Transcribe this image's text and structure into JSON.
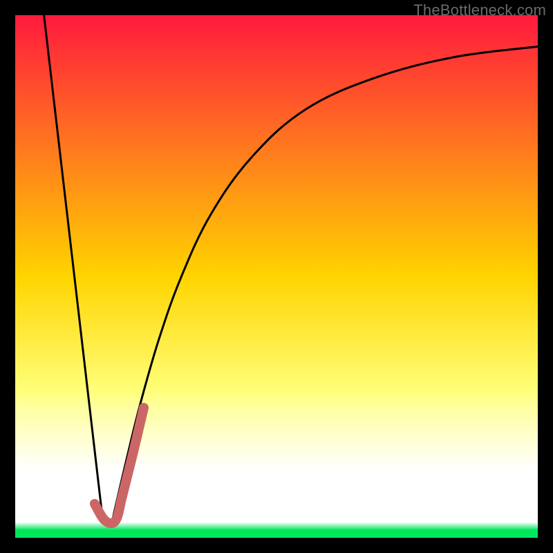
{
  "watermark": "TheBottleneck.com",
  "chart_data": {
    "type": "line",
    "title": "",
    "xlabel": "",
    "ylabel": "",
    "xlim": [
      0,
      100
    ],
    "ylim": [
      0,
      100
    ],
    "gradient_bands": [
      {
        "t": 0.0,
        "color": "#ff1a3d"
      },
      {
        "t": 0.5,
        "color": "#ffd400"
      },
      {
        "t": 0.72,
        "color": "#ffff7a"
      },
      {
        "t": 0.75,
        "color": "#ffffa0"
      },
      {
        "t": 0.8,
        "color": "#ffffc8"
      },
      {
        "t": 0.87,
        "color": "#ffffff"
      },
      {
        "t": 0.97,
        "color": "#ffffff"
      },
      {
        "t": 0.985,
        "color": "#00e75c"
      },
      {
        "t": 1.0,
        "color": "#00e75c"
      }
    ],
    "series": [
      {
        "name": "left-line",
        "stroke": "#000000",
        "stroke_width": 3,
        "points": [
          {
            "x": 5.5,
            "y": 100
          },
          {
            "x": 16.8,
            "y": 3
          }
        ]
      },
      {
        "name": "right-curve",
        "stroke": "#000000",
        "stroke_width": 3,
        "points": [
          {
            "x": 18.5,
            "y": 3
          },
          {
            "x": 21.3,
            "y": 15
          },
          {
            "x": 23.9,
            "y": 25.5
          },
          {
            "x": 27.5,
            "y": 38
          },
          {
            "x": 31.8,
            "y": 50
          },
          {
            "x": 37.5,
            "y": 62
          },
          {
            "x": 45.4,
            "y": 73
          },
          {
            "x": 55.6,
            "y": 82
          },
          {
            "x": 68.8,
            "y": 88
          },
          {
            "x": 84.1,
            "y": 92
          },
          {
            "x": 100.0,
            "y": 94
          }
        ]
      },
      {
        "name": "highlight-hook",
        "stroke": "#cc6666",
        "stroke_width": 14,
        "linecap": "round",
        "points": [
          {
            "x": 15.2,
            "y": 6.5
          },
          {
            "x": 17.2,
            "y": 3.3
          },
          {
            "x": 19.2,
            "y": 3.3
          },
          {
            "x": 20.5,
            "y": 8
          },
          {
            "x": 22.5,
            "y": 16
          },
          {
            "x": 24.6,
            "y": 24.9
          }
        ]
      }
    ]
  }
}
